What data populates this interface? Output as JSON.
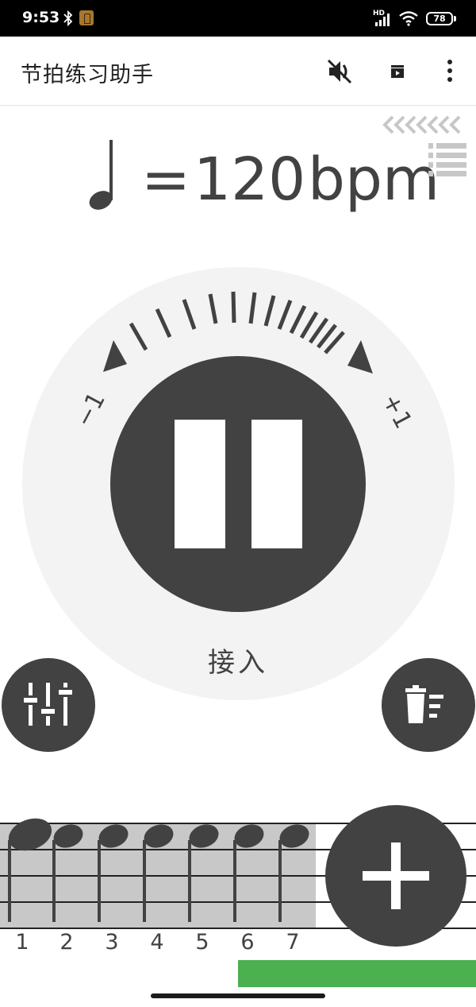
{
  "status_bar": {
    "time": "9:53",
    "network_label": "HD",
    "battery": "78",
    "icons": [
      "bluetooth-icon",
      "app-notification-icon",
      "signal-icon",
      "wifi-icon",
      "battery-icon"
    ]
  },
  "app_bar": {
    "title": "节拍练习助手",
    "actions": [
      "volume-off-icon",
      "clapperboard-icon",
      "more-vert-icon"
    ]
  },
  "tempo": {
    "equal": "=",
    "value": "120",
    "unit": "bpm"
  },
  "dial": {
    "minus_label": "−1",
    "plus_label": "+1",
    "tap_label": "接入"
  },
  "beats": {
    "numbers": [
      "1",
      "2",
      "3",
      "4",
      "5",
      "6",
      "7"
    ],
    "accent_beat": 1,
    "progress": 0.5
  },
  "colors": {
    "primary_dark": "#424242",
    "dial_bg": "#f3f3f3",
    "beat_highlight": "#c8c8c8",
    "progress": "#4caf50",
    "icon_light": "#c7c7c7"
  }
}
